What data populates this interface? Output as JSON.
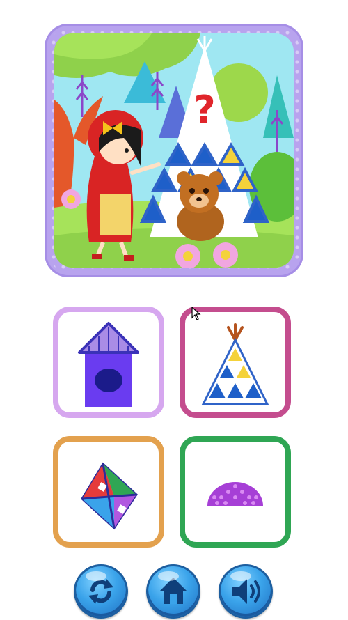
{
  "scene": {
    "question_mark": "?",
    "characters": [
      "girl-in-red-hood",
      "bear"
    ],
    "puzzle": "which-house-matches"
  },
  "answers": [
    {
      "id": "house",
      "icon": "birdhouse-icon",
      "border_color": "#d6a7ef"
    },
    {
      "id": "tent",
      "icon": "tent-icon",
      "border_color": "#c44d8e"
    },
    {
      "id": "kite",
      "icon": "kite-icon",
      "border_color": "#e3a14e"
    },
    {
      "id": "dome",
      "icon": "dome-icon",
      "border_color": "#2fa654"
    }
  ],
  "controls": [
    {
      "id": "restart",
      "icon": "restart-icon"
    },
    {
      "id": "home",
      "icon": "home-icon"
    },
    {
      "id": "sound",
      "icon": "speaker-icon"
    }
  ],
  "colors": {
    "accent_blue": "#3aa3ea",
    "frame_purple": "#b8a3ee",
    "question_red": "#e0252b"
  }
}
